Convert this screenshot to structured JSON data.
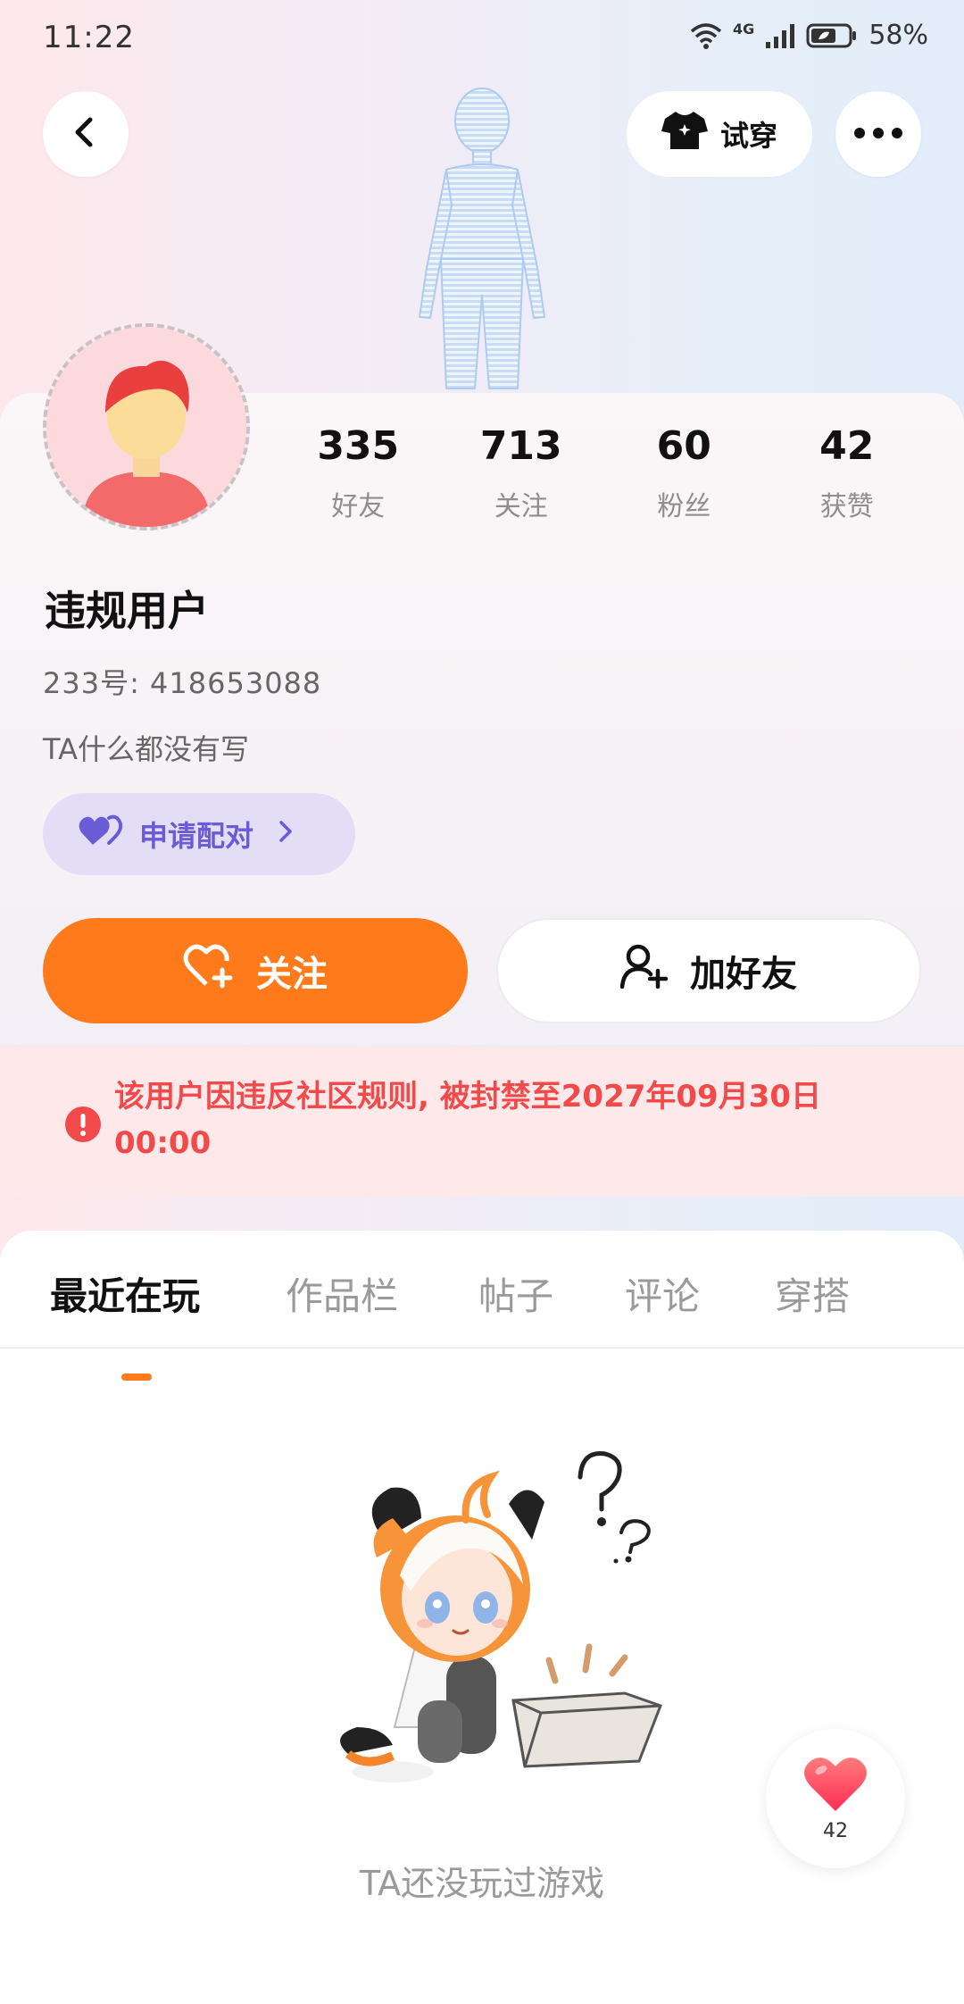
{
  "status_bar": {
    "time": "11:22",
    "network": "4G",
    "battery": "58%"
  },
  "header": {
    "tryon_label": "试穿"
  },
  "stats": [
    {
      "value": "335",
      "label": "好友"
    },
    {
      "value": "713",
      "label": "关注"
    },
    {
      "value": "60",
      "label": "粉丝"
    },
    {
      "value": "42",
      "label": "获赞"
    }
  ],
  "profile": {
    "name": "违规用户",
    "id_text": "233号: 418653088",
    "bio": "TA什么都没有写",
    "pair_label": "申请配对"
  },
  "actions": {
    "follow_label": "关注",
    "add_friend_label": "加好友"
  },
  "ban_notice": "该用户因违反社区规则, 被封禁至2027年09月30日00:00",
  "tabs": [
    "最近在玩",
    "作品栏",
    "帖子",
    "评论",
    "穿搭"
  ],
  "empty_state": "TA还没玩过游戏",
  "like_fab": {
    "count": "42"
  },
  "colors": {
    "accent": "#ff7a1a",
    "pair": "#6a5bd6",
    "danger": "#f24a4a"
  }
}
